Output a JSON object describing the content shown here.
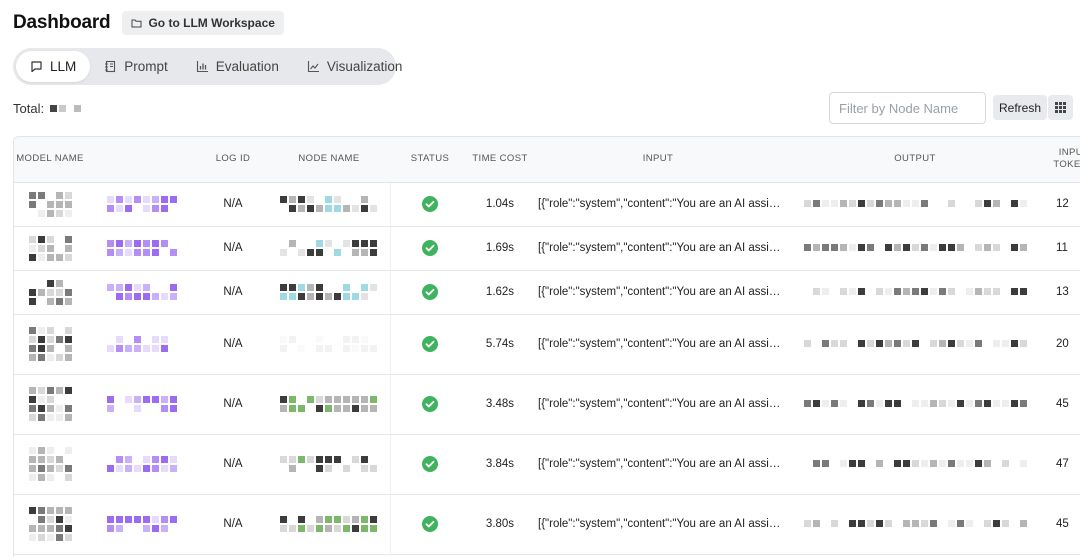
{
  "header": {
    "title": "Dashboard",
    "workspace_button": "Go to LLM Workspace"
  },
  "tabs": [
    {
      "label": "LLM",
      "icon": "message-square-icon",
      "active": true
    },
    {
      "label": "Prompt",
      "icon": "notebook-icon",
      "active": false
    },
    {
      "label": "Evaluation",
      "icon": "bar-chart-icon",
      "active": false
    },
    {
      "label": "Visualization",
      "icon": "line-chart-icon",
      "active": false
    }
  ],
  "total_label": "Total:",
  "filter": {
    "placeholder": "Filter by Node Name",
    "value": ""
  },
  "refresh_label": "Refresh",
  "table": {
    "columns": [
      "MODEL NAME",
      "",
      "LOG ID",
      "NODE NAME",
      "STATUS",
      "TIME COST",
      "INPUT",
      "OUTPUT",
      "INPUT TOKENS"
    ],
    "rows": [
      {
        "log_id": "N/A",
        "status": "success",
        "time_cost": "1.04s",
        "input": "[{\"role\":\"system\",\"content\":\"You are an AI assistant...",
        "input_tokens": "12"
      },
      {
        "log_id": "N/A",
        "status": "success",
        "time_cost": "1.69s",
        "input": "[{\"role\":\"system\",\"content\":\"You are an AI assistant...",
        "input_tokens": "11"
      },
      {
        "log_id": "N/A",
        "status": "success",
        "time_cost": "1.62s",
        "input": "[{\"role\":\"system\",\"content\":\"You are an AI assistant...",
        "input_tokens": "13"
      },
      {
        "log_id": "N/A",
        "status": "success",
        "time_cost": "5.74s",
        "input": "[{\"role\":\"system\",\"content\":\"You are an AI assistant...",
        "input_tokens": "20"
      },
      {
        "log_id": "N/A",
        "status": "success",
        "time_cost": "3.48s",
        "input": "[{\"role\":\"system\",\"content\":\"You are an AI assistant...",
        "input_tokens": "45"
      },
      {
        "log_id": "N/A",
        "status": "success",
        "time_cost": "3.84s",
        "input": "[{\"role\":\"system\",\"content\":\"You are an AI assistant...",
        "input_tokens": "47"
      },
      {
        "log_id": "N/A",
        "status": "success",
        "time_cost": "3.80s",
        "input": "[{\"role\":\"system\",\"content\":\"You are an AI assistant...",
        "input_tokens": "45"
      }
    ]
  },
  "colors": {
    "status_success": "#3fb35f",
    "tab_bar_bg": "#e7e8eb",
    "mask_purple": "#9b6bf2",
    "mask_green": "#7db86a",
    "mask_cyan": "#9fd9e3"
  }
}
